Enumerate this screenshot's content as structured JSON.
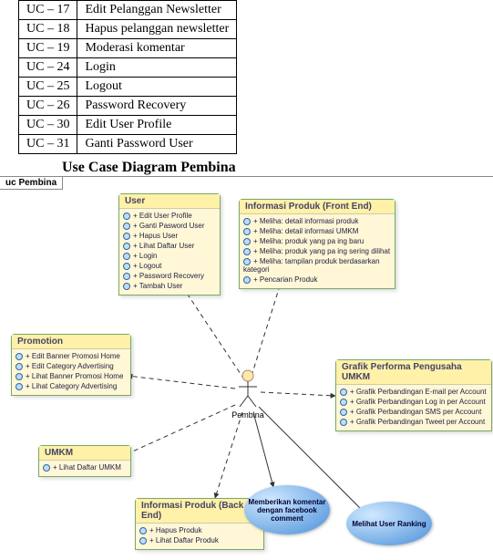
{
  "table": {
    "rows": [
      {
        "code": "UC – 17",
        "name": "Edit Pelanggan Newsletter"
      },
      {
        "code": "UC – 18",
        "name": "Hapus pelanggan newsletter"
      },
      {
        "code": "UC – 19",
        "name": "Moderasi komentar"
      },
      {
        "code": "UC – 24",
        "name": "Login"
      },
      {
        "code": "UC – 25",
        "name": "Logout"
      },
      {
        "code": "UC – 26",
        "name": "Password Recovery"
      },
      {
        "code": "UC – 30",
        "name": "Edit User Profile"
      },
      {
        "code": "UC – 31",
        "name": "Ganti Password User"
      }
    ]
  },
  "title": "Use Case Diagram Pembina",
  "diagram": {
    "frame_label": "uc Pembina",
    "actor": "Pembina",
    "boxes": {
      "user": {
        "title": "User",
        "items": [
          "+ Edit User Profile",
          "+ Ganti Pasword User",
          "+ Hapus User",
          "+ Lihat Daftar User",
          "+ Login",
          "+ Logout",
          "+ Password Recovery",
          "+ Tambah User"
        ]
      },
      "info_front": {
        "title": "Informasi Produk (Front End)",
        "items": [
          "+ Meliha: detail informasi produk",
          "+ Meliha: detail informasi UMKM",
          "+ Meliha: produk yang pa ing baru",
          "+ Meliha: produk yang pa ing sering dilihat",
          "+ Meliha: tampilan produk berdasarkan kategori",
          "+ Pencarian Produk"
        ]
      },
      "promotion": {
        "title": "Promotion",
        "items": [
          "+ Edit Banner Promosi Home",
          "+ Edit Category Advertising",
          "+ Lihat Banner Promosi Home",
          "+ Lihat Category Advertising"
        ]
      },
      "grafik": {
        "title": "Grafik Performa Pengusaha UMKM",
        "items": [
          "+ Grafik Perbandingan E-mail per Account",
          "+ Grafik Perbandingan Log in per Account",
          "+ Grafik Perbandingan SMS per Account",
          "+ Grafik Perbandingan Tweet per Account"
        ]
      },
      "umkm": {
        "title": "UMKM",
        "items": [
          "+ Lihat Daftar UMKM"
        ]
      },
      "info_back": {
        "title": "Informasi Produk (Back End)",
        "items": [
          "+ Hapus Produk",
          "+ Lihat Daftar Produk"
        ]
      }
    },
    "ellipses": {
      "comment": "Memberikan komentar dengan facebook comment",
      "ranking": "Melihat User Ranking"
    }
  }
}
